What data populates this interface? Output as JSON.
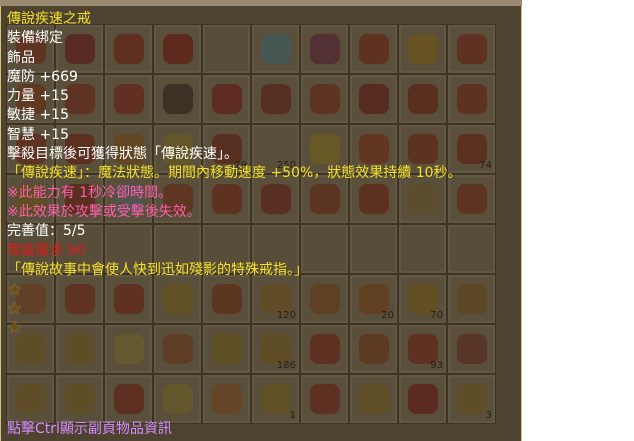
{
  "item": {
    "name": "傳說疾速之戒",
    "binding": "裝備綁定",
    "category": "飾品",
    "stats": [
      "魔防 +669",
      "力量 +15",
      "敏捷 +15",
      "智慧 +15"
    ],
    "effect_trigger": "擊殺目標後可獲得狀態「傳說疾速」。",
    "effect_detail": "「傳說疾速」：魔法狀態。期間內移動速度 +50%，狀態效果持續 10秒。",
    "notes": [
      "※此能力有 1秒冷卻時間。",
      "※此效果於攻擊或受擊後失效。"
    ],
    "completion": "完善值：5/5",
    "level_req": "等級需求 90",
    "lore": "「傳說故事中會使人快到迅如殘影的特殊戒指。」",
    "star_count": 3,
    "star_icon": "star-icon",
    "footer_hint": "點擊Ctrl顯示副頁物品資訊"
  },
  "inventory": {
    "quantities": [
      "79",
      "250",
      "74",
      "120",
      "20",
      "70",
      "186",
      "6",
      "93",
      "1",
      "3",
      "6"
    ]
  },
  "colors": {
    "name": "#f3e027",
    "white": "#ffffff",
    "pink": "#ff5ea8",
    "red": "#e41a18",
    "hint": "#d38cff"
  }
}
